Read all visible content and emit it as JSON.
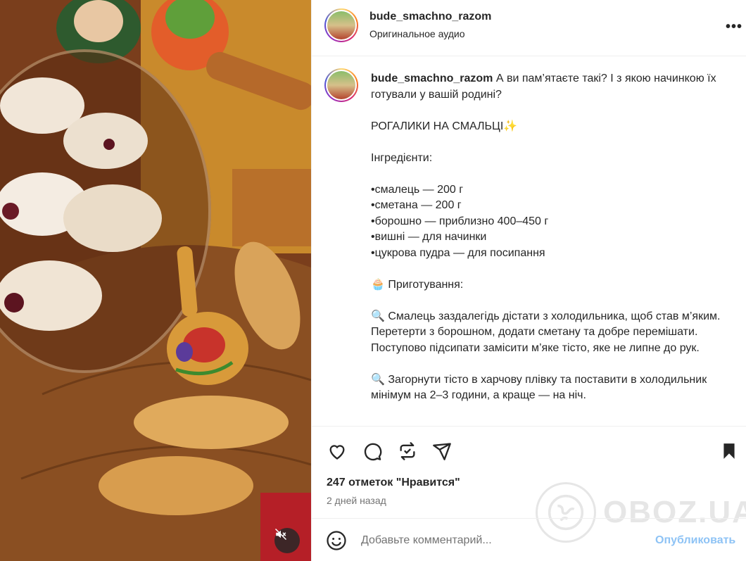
{
  "post": {
    "username": "bude_smachno_razom",
    "audio": "Оригинальное аудио",
    "more_icon": "more-horizontal-icon"
  },
  "caption": {
    "username": "bude_smachno_razom",
    "text": " А ви пам’ятаєте такі? І з якою начинкою їх готували у вашій родині?\n\nРОГАЛИКИ НА СМАЛЬЦІ✨\n\nІнгредієнти:\n\n•смалець — 200 г\n•сметана — 200 г\n•борошно — приблизно 400–450 г\n•вишні — для начинки\n•цукрова пудра — для посипання\n\n🧁 Приготування:\n\n🔍 Смалець заздалегідь дістати з холодильника, щоб став м’яким. Перетерти з борошном, додати сметану та добре перемішати. Поступово підсипати замісити м’яке тісто, яке не липне до рук.\n\n🔍 Загорнути тісто в харчову плівку та поставити в холодильник мінімум на 2–3 години, а краще — на ніч."
  },
  "actions": {
    "likes": "247 отметок \"Нравится\"",
    "date": "2 дней назад",
    "icons": [
      "heart-icon",
      "comment-icon",
      "repost-icon",
      "share-icon",
      "bookmark-icon"
    ]
  },
  "comment": {
    "placeholder": "Добавьте комментарий...",
    "post_label": "Опубликовать"
  },
  "watermark": {
    "text": "OBOZ.UA"
  },
  "colors": {
    "text": "#262626",
    "secondary": "#737373",
    "post_button": "#8ec3f5",
    "border": "#efefef"
  }
}
